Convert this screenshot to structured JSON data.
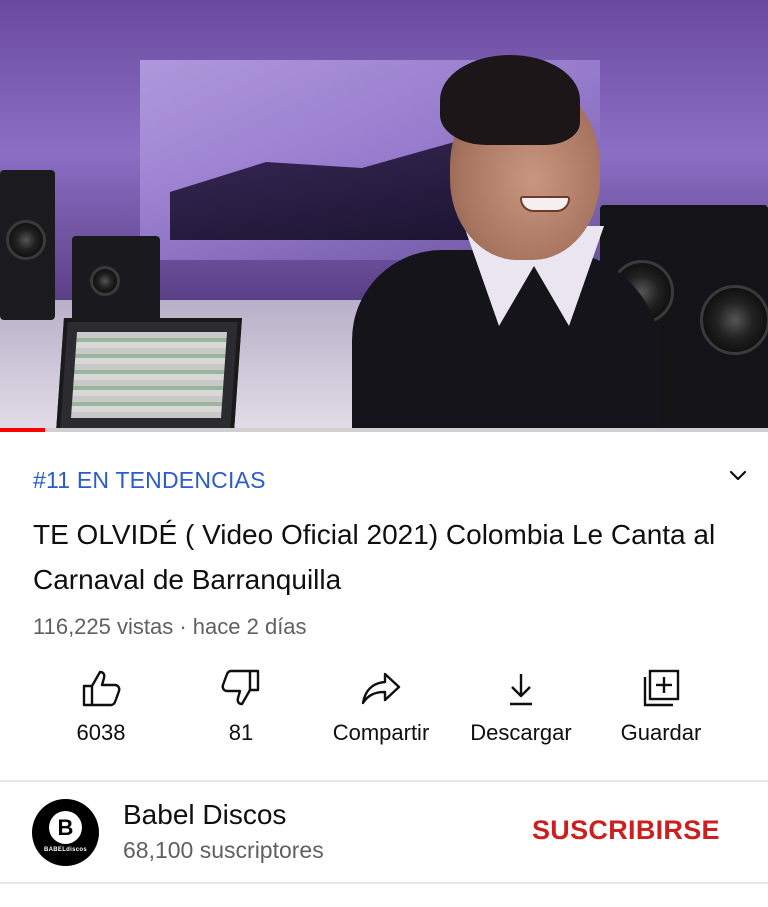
{
  "video": {
    "progress_fraction": 0.058,
    "progress_color": "#ff0000"
  },
  "trending_badge": "#11 EN TENDENCIAS",
  "title": "TE OLVIDÉ ( Video Oficial 2021) Colombia Le Canta al Carnaval de Barranquilla",
  "meta": "116,225 vistas · hace 2 días",
  "actions": {
    "like": {
      "label": "6038",
      "icon": "thumb-up-icon"
    },
    "dislike": {
      "label": "81",
      "icon": "thumb-down-icon"
    },
    "share": {
      "label": "Compartir",
      "icon": "share-arrow-icon"
    },
    "download": {
      "label": "Descargar",
      "icon": "download-icon"
    },
    "save": {
      "label": "Guardar",
      "icon": "add-to-playlist-icon"
    }
  },
  "channel": {
    "name": "Babel Discos",
    "subscribers": "68,100 suscriptores",
    "avatar_letter": "B",
    "avatar_caption": "BABELdiscos",
    "subscribe_label": "SUSCRIBIRSE",
    "subscribe_color": "#cc1f1f"
  },
  "colors": {
    "trending": "#2a5bd0",
    "secondary_text": "#606060"
  }
}
